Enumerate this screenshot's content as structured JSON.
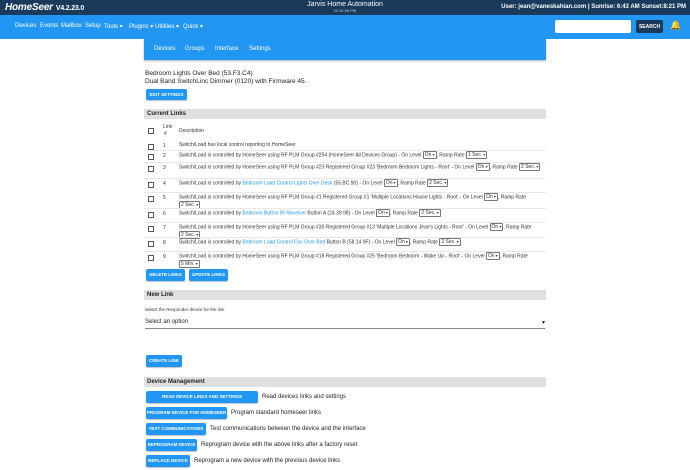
{
  "topbar": {
    "logo": "HomeSeer",
    "version": "V4.2.23.0",
    "system_name": "Jarvis Home Automation",
    "time": "11:19:06 PM",
    "user_info": "User: jean@vaneskahian.com | Sunrise: 6:43 AM Sunset:8:21 PM"
  },
  "nav": {
    "items": [
      "Devices",
      "Events",
      "Mailbox",
      "Setup",
      "Tools ▾",
      "Plugins ▾",
      "Utilities ▾",
      "Quick ▾"
    ],
    "search_placeholder": "",
    "search_label": "SEARCH",
    "bell_icon": "bell-icon"
  },
  "subnav": {
    "items": [
      "Devices",
      "Groups",
      "Interface",
      "Settings"
    ]
  },
  "device": {
    "name": "Bedroom Lights Over Bed (53.F3.C4)",
    "description": "Dual Band SwitchLinc Dimmer (0120) with Firmware 45.",
    "edit_label": "EDIT SETTINGS"
  },
  "current_links": {
    "title": "Current Links",
    "col_link": "Link",
    "col_hash": "#",
    "col_desc": "Description",
    "rows": [
      {
        "num": "1",
        "parts": [
          {
            "t": "Switch/Load has local control reporting to HomeSeer"
          }
        ]
      },
      {
        "num": "2",
        "parts": [
          {
            "t": "Switch/Load is controlled by HomeSeer using RF PLM Group #254 (HomeSeer All Devices Group) - On Level "
          },
          {
            "s": "On"
          },
          {
            "t": ", Ramp Rate "
          },
          {
            "s": "1 Sec."
          }
        ]
      },
      {
        "num": "3",
        "parts": [
          {
            "t": "Switch/Load is controlled by HomeSeer using RF PLM Group #23 Registered Group #23 'Bedroom Bedroom Lights - Root' - On Level "
          },
          {
            "s": "On"
          },
          {
            "t": ", Ramp Rate "
          },
          {
            "s": "2 Sec."
          }
        ]
      },
      {
        "num": "4",
        "parts": [
          {
            "t": "Switch/Load is controlled by "
          },
          {
            "l": "Bedroom Load Control Lights Over Desk"
          },
          {
            "t": " (55.BC.90) - On Level "
          },
          {
            "s": "On"
          },
          {
            "t": ", Ramp Rate "
          },
          {
            "s": "2 Sec."
          }
        ]
      },
      {
        "num": "5",
        "parts": [
          {
            "t": "Switch/Load is controlled by HomeSeer using RF PLM Group #1 Registered Group #1 'Multiple Locations House Lights - Root' - On Level "
          },
          {
            "s": "On"
          },
          {
            "t": ", Ramp Rate "
          },
          {
            "s": "2 Sec."
          }
        ]
      },
      {
        "num": "6",
        "parts": [
          {
            "t": "Switch/Load is controlled by "
          },
          {
            "l": "Bedroom Button IR Receiver"
          },
          {
            "t": " Button A (24.39.98) - On Level "
          },
          {
            "s": "On"
          },
          {
            "t": ", Ramp Rate "
          },
          {
            "s": "2 Sec."
          }
        ]
      },
      {
        "num": "7",
        "parts": [
          {
            "t": "Switch/Load is controlled by HomeSeer using RF PLM Group #30 Registered Group #13 'Multiple Locations Jean's Lights - Root' - On Level "
          },
          {
            "s": "On"
          },
          {
            "t": ", Ramp Rate "
          },
          {
            "s": "2 Sec."
          }
        ]
      },
      {
        "num": "8",
        "parts": [
          {
            "t": "Switch/Load is controlled by "
          },
          {
            "l": "Bedroom Load Control Fan Over Bed"
          },
          {
            "t": " Button B (58.14.9F) - On Level "
          },
          {
            "s": "On"
          },
          {
            "t": ", Ramp Rate "
          },
          {
            "s": "2 Sec."
          }
        ]
      },
      {
        "num": "9",
        "parts": [
          {
            "t": "Switch/Load is controlled by HomeSeer using RF PLM Group #18 Registered Group #25 'Bedroom Bedroom - Wake Up - Root' - On Level "
          },
          {
            "s": "On"
          },
          {
            "t": ", Ramp Rate "
          },
          {
            "s": "5 Min."
          }
        ]
      }
    ],
    "delete_label": "DELETE LINKS",
    "update_label": "UPDATE LINKS"
  },
  "new_link": {
    "title": "New Link",
    "hint": "Select the Responder device for the link",
    "select_value": "Select an option",
    "create_label": "CREATE LINK"
  },
  "device_management": {
    "title": "Device Management",
    "items": [
      {
        "label": "READ DEVICE LINKS AND SETTINGS",
        "desc": "Read devices links and settings"
      },
      {
        "label": "PROGRAM DEVICE FOR HOMESEER",
        "desc": "Program standard homeseer links"
      },
      {
        "label": "TEST COMMUNICATIONS",
        "desc": "Test communications between the device and the interface"
      },
      {
        "label": "REPROGRAM DEVICE",
        "desc": "Reprogram device with the above links after a factory reset"
      },
      {
        "label": "REPLACE DEVICE",
        "desc": "Reprogram a new device with the previous device links"
      }
    ]
  },
  "colors": {
    "primary": "#2196f3",
    "topbar": "#1a3a5c",
    "section_bg": "#e0e0e0"
  }
}
